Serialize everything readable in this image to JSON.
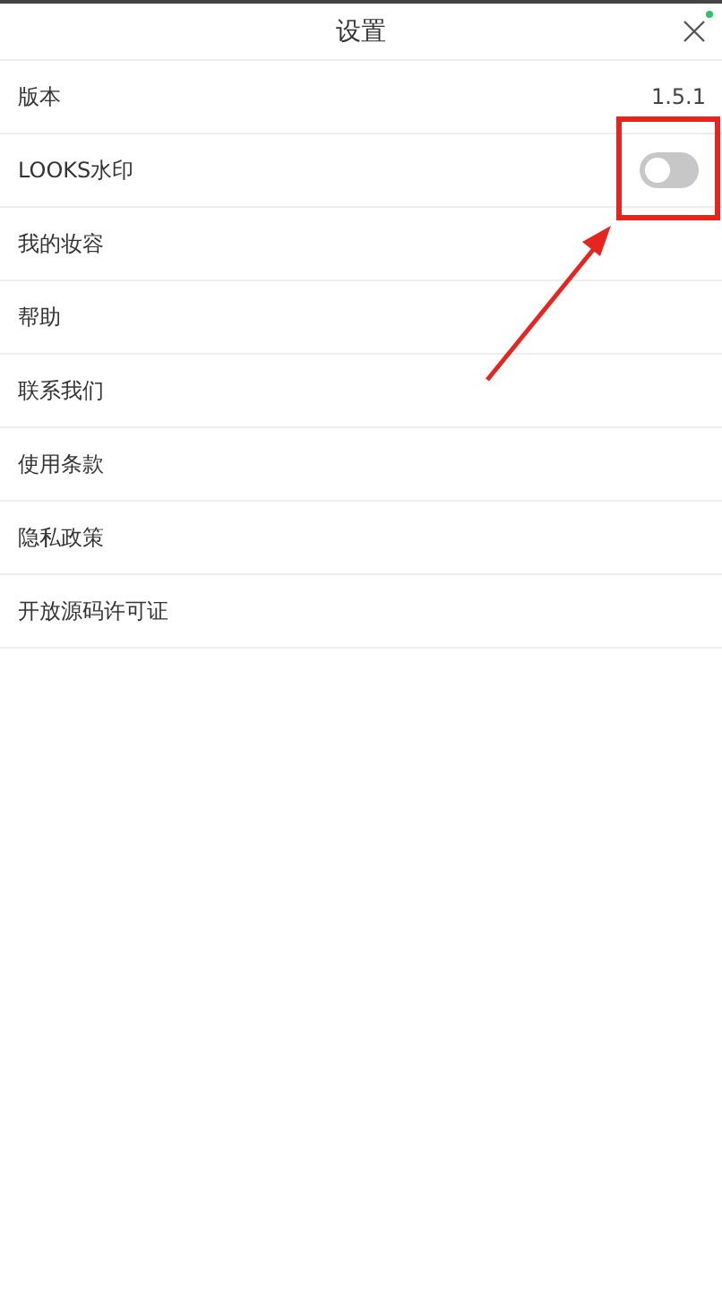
{
  "header": {
    "title": "设置"
  },
  "items": [
    {
      "kind": "value",
      "label": "版本",
      "value": "1.5.1"
    },
    {
      "kind": "toggle",
      "label": "LOOKS水印",
      "on": false
    },
    {
      "kind": "link",
      "label": "我的妆容"
    },
    {
      "kind": "link",
      "label": "帮助"
    },
    {
      "kind": "link",
      "label": "联系我们"
    },
    {
      "kind": "link",
      "label": "使用条款"
    },
    {
      "kind": "link",
      "label": "隐私政策"
    },
    {
      "kind": "link",
      "label": "开放源码许可证"
    }
  ]
}
